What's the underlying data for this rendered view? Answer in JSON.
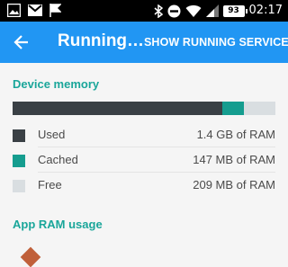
{
  "status_bar": {
    "time": "02:17",
    "battery": "93",
    "icons": [
      "image-icon",
      "gmail-icon",
      "flag-icon",
      "bluetooth-icon",
      "do-not-disturb-icon",
      "wifi-icon",
      "signal-icon"
    ]
  },
  "app_bar": {
    "title": "Running…",
    "action": "SHOW RUNNING SERVICES",
    "back_icon": "back-arrow-icon",
    "color": "#2196f3"
  },
  "device_memory": {
    "header": "Device memory",
    "accent_color": "#1aa69a",
    "bar": {
      "used_fraction": 0.798,
      "cached_fraction": 0.082,
      "free_fraction": 0.12
    },
    "legend": [
      {
        "label": "Used",
        "value": "1.4 GB of RAM",
        "color": "#3a4045"
      },
      {
        "label": "Cached",
        "value": "147 MB of RAM",
        "color": "#159d8f"
      },
      {
        "label": "Free",
        "value": "209 MB of RAM",
        "color": "#d9dee1"
      }
    ]
  },
  "app_ram": {
    "header": "App RAM usage"
  }
}
